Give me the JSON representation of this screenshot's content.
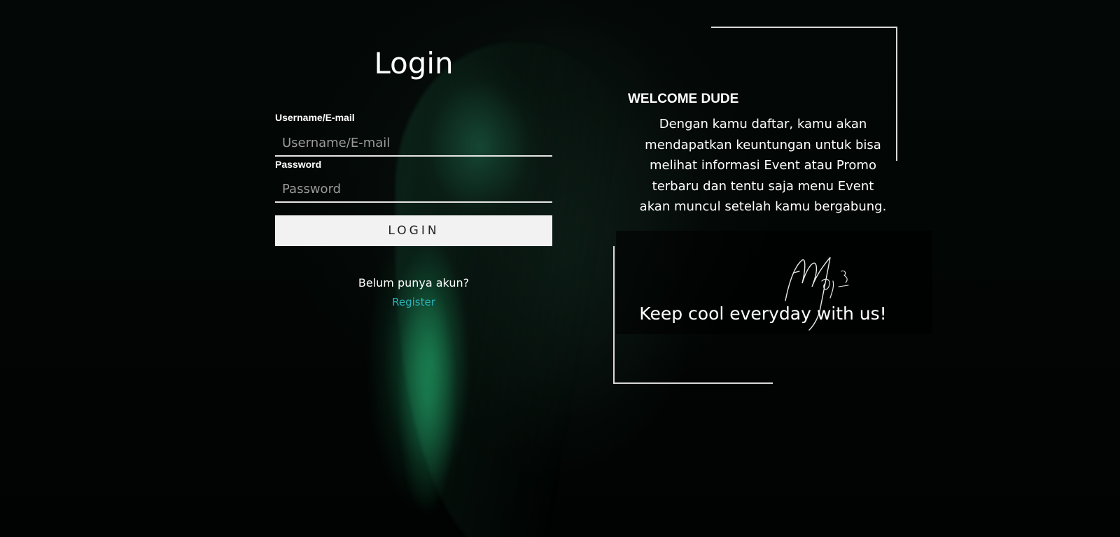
{
  "login": {
    "title": "Login",
    "username_label": "Username/E-mail",
    "username_placeholder": "Username/E-mail",
    "password_label": "Password",
    "password_placeholder": "Password",
    "login_button": "LOGIN",
    "no_account_text": "Belum punya akun?",
    "register_link": "Register"
  },
  "welcome": {
    "title": "WELCOME DUDE",
    "text": "Dengan kamu daftar, kamu akan mendapatkan keuntungan untuk bisa melihat informasi Event atau Promo terbaru dan tentu saja menu Event akan muncul setelah kamu bergabung.",
    "slogan": "Keep cool everyday with us!"
  },
  "colors": {
    "background": "#020504",
    "accent_link": "#2bb3b8",
    "button_bg": "#f2f2f2",
    "frame_line": "#d9d9d9"
  },
  "icons": {
    "signature": "handwritten-signature"
  }
}
